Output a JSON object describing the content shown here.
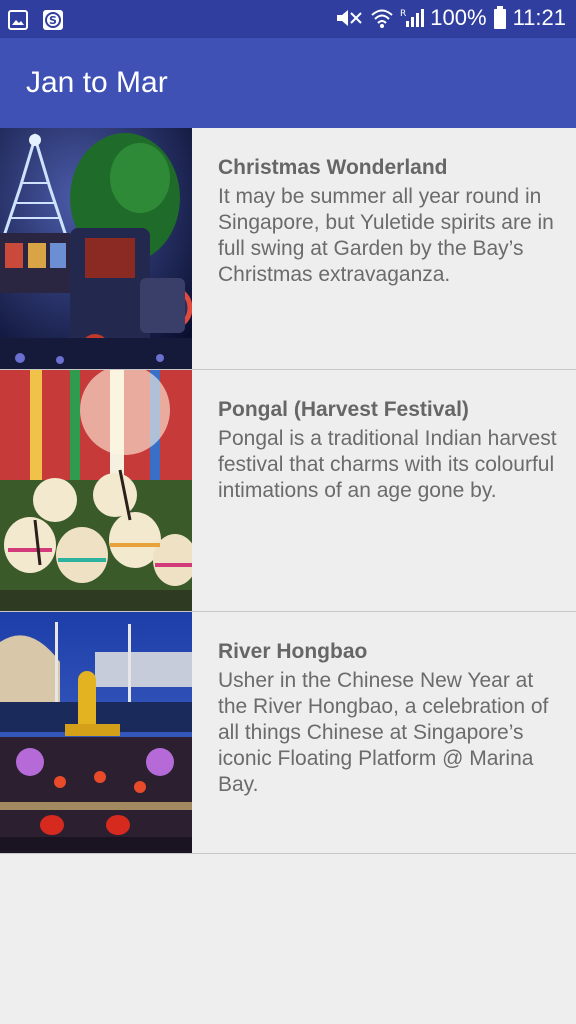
{
  "status_bar": {
    "battery": "100%",
    "time": "11:21",
    "icons": [
      "image-icon",
      "s-app-icon",
      "mute-icon",
      "wifi-icon",
      "signal-icon",
      "battery-icon"
    ]
  },
  "app_bar": {
    "title": "Jan to Mar"
  },
  "colors": {
    "status_bar": "#303f9f",
    "app_bar": "#3f51b5",
    "background": "#eeeeee"
  },
  "items": [
    {
      "title": "Christmas Wonderland",
      "description": "It may be summer all year round in Singapore, but Yuletide spirits are in full swing at Garden by the Bay’s Christmas extravaganza."
    },
    {
      "title": "Pongal (Harvest Festival)",
      "description": "Pongal is a traditional Indian harvest festival that charms with its colourful intimations of an age gone by."
    },
    {
      "title": "River Hongbao",
      "description": "Usher in the Chinese New Year at the River Hongbao, a celebration of all things Chinese at Singapore’s iconic Floating Platform @ Marina Bay."
    }
  ]
}
